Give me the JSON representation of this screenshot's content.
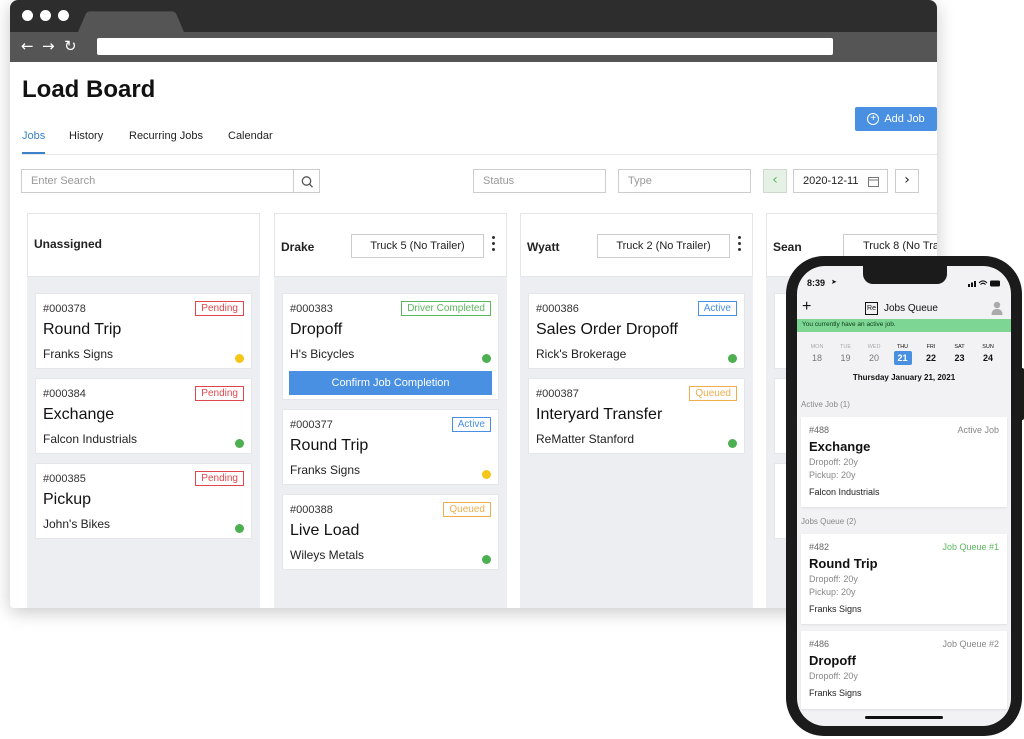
{
  "browser": {
    "address": ""
  },
  "page": {
    "title": "Load Board"
  },
  "tabs": [
    "Jobs",
    "History",
    "Recurring Jobs",
    "Calendar"
  ],
  "add_job_label": "Add Job",
  "filters": {
    "search_placeholder": "Enter Search",
    "status_placeholder": "Status",
    "type_placeholder": "Type",
    "date": "2020-12-11"
  },
  "columns": [
    {
      "name": "Unassigned",
      "truck": ""
    },
    {
      "name": "Drake",
      "truck": "Truck 5 (No Trailer)"
    },
    {
      "name": "Wyatt",
      "truck": "Truck 2 (No Trailer)"
    },
    {
      "name": "Sean",
      "truck": "Truck 8 (No Tra"
    }
  ],
  "cards": [
    {
      "col": 0,
      "num": "#000378",
      "title": "Round Trip",
      "company": "Franks Signs",
      "badge": "Pending",
      "dot": "yellow"
    },
    {
      "col": 0,
      "num": "#000384",
      "title": "Exchange",
      "company": "Falcon Industrials",
      "badge": "Pending",
      "dot": "green"
    },
    {
      "col": 0,
      "num": "#000385",
      "title": "Pickup",
      "company": "John's Bikes",
      "badge": "Pending",
      "dot": "green"
    },
    {
      "col": 1,
      "num": "#000383",
      "title": "Dropoff",
      "company": "H's Bicycles",
      "badge": "Driver Completed",
      "dot": "green",
      "action": "Confirm Job Completion"
    },
    {
      "col": 1,
      "num": "#000377",
      "title": "Round Trip",
      "company": "Franks Signs",
      "badge": "Active",
      "dot": "yellow"
    },
    {
      "col": 1,
      "num": "#000388",
      "title": "Live Load",
      "company": "Wileys Metals",
      "badge": "Queued",
      "dot": "green"
    },
    {
      "col": 2,
      "num": "#000386",
      "title": "Sales Order Dropoff",
      "company": "Rick's Brokerage",
      "badge": "Active",
      "dot": "green"
    },
    {
      "col": 2,
      "num": "#000387",
      "title": "Interyard Transfer",
      "company": "ReMatter Stanford",
      "badge": "Queued",
      "dot": "green"
    }
  ],
  "colors": {
    "accent": "#4a90e2",
    "pending": "#e0474c",
    "driver_completed": "#5cb85c",
    "active": "#4a90e2",
    "queued": "#f0ad4e",
    "dot_green": "#4caf50",
    "dot_yellow": "#f5c518",
    "banner_green": "#7ed695"
  },
  "phone": {
    "time": "8:39",
    "title": "Jobs Queue",
    "logo": "Re",
    "banner": "You currently have an active job.",
    "week": [
      {
        "dn": "MON",
        "dd": "18"
      },
      {
        "dn": "TUE",
        "dd": "19"
      },
      {
        "dn": "WED",
        "dd": "20"
      },
      {
        "dn": "THU",
        "dd": "21"
      },
      {
        "dn": "FRI",
        "dd": "22"
      },
      {
        "dn": "SAT",
        "dd": "23"
      },
      {
        "dn": "SUN",
        "dd": "24"
      }
    ],
    "selected_date": "Thursday January 21, 2021",
    "active_section": "Active Job (1)",
    "queue_section": "Jobs Queue (2)",
    "jobs": [
      {
        "num": "#488",
        "title": "Exchange",
        "status": "Active Job",
        "dropoff": "Dropoff: 20y",
        "pickup": "Pickup: 20y",
        "company": "Falcon Industrials"
      },
      {
        "num": "#482",
        "title": "Round Trip",
        "status": "Job Queue #1",
        "dropoff": "Dropoff: 20y",
        "pickup": "Pickup: 20y",
        "company": "Franks Signs"
      },
      {
        "num": "#486",
        "title": "Dropoff",
        "status": "Job Queue #2",
        "dropoff": "Dropoff: 20y",
        "pickup": "",
        "company": "Franks Signs"
      }
    ]
  }
}
